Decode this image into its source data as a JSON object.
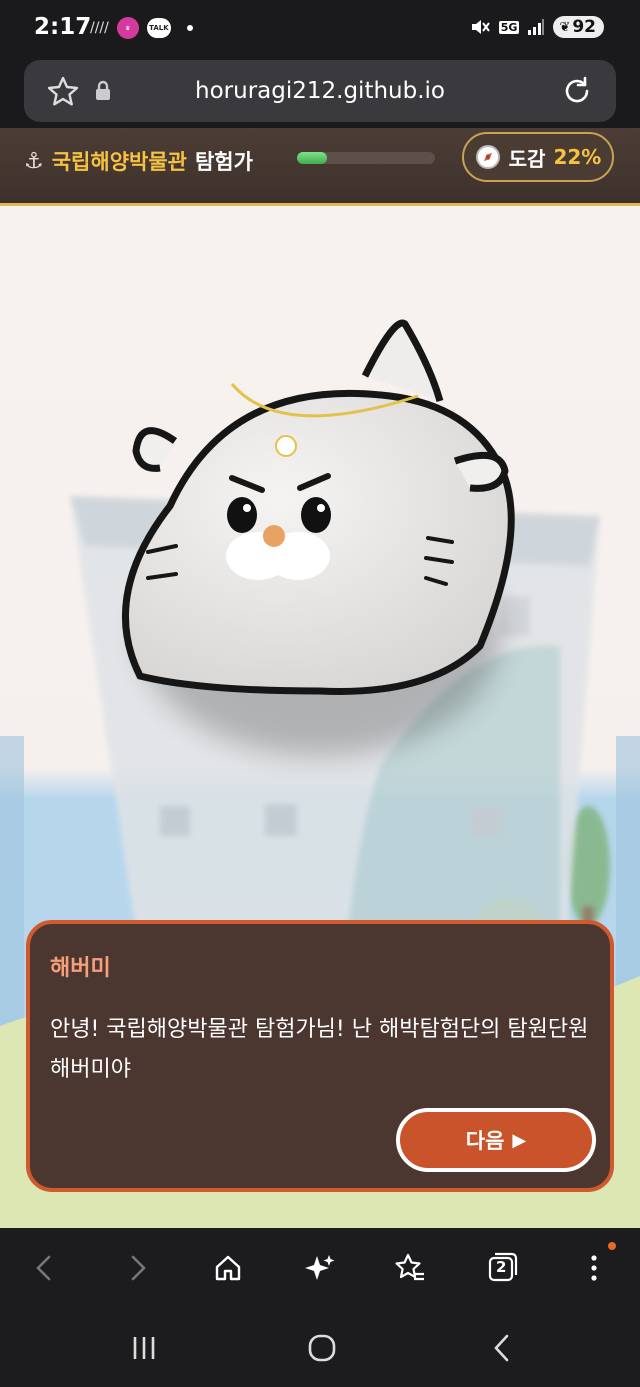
{
  "status_bar": {
    "time": "2:17",
    "left_icons": [
      "data-saver-icon",
      "queen-good-app-icon",
      "kakaotalk-icon",
      "notification-dot"
    ],
    "talk_label": "TALK",
    "network": "5G",
    "battery": "92"
  },
  "browser": {
    "url": "horuragi212.github.io",
    "tab_count": "2"
  },
  "game_header": {
    "anchor_icon": "anchor-icon",
    "title_highlight": "국립해양박물관",
    "title_rest": "탐험가",
    "progress_value": 0.22,
    "dex_icon": "compass-icon",
    "dex_label": "도감",
    "dex_percent": "22%"
  },
  "dialog": {
    "speaker": "해버미",
    "text": "안녕! 국립해양박물관 탐험가님! 난 해박탐험단의 탐원단원 해버미야",
    "next_label": "다음",
    "next_icon": "play-triangle-icon"
  },
  "colors": {
    "header_bg": "#4c3d36",
    "accent_gold": "#f5c242",
    "dialog_bg": "#4b3630",
    "dialog_border": "#cf5a2d",
    "speaker_color": "#f4a07b",
    "progress_green": "#4fc060"
  }
}
